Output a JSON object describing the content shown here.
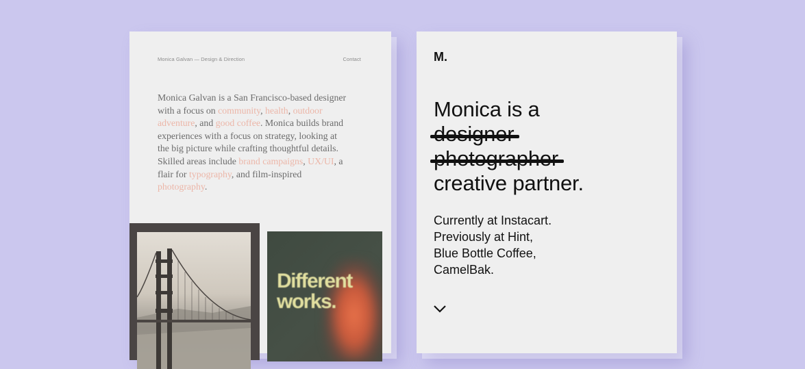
{
  "left": {
    "nav": {
      "title": "Monica Galvan — Design & Direction",
      "contact": "Contact"
    },
    "bio": [
      {
        "text": "Monica Galvan is a San Francisco-based designer with a focus on ",
        "hl": false
      },
      {
        "text": "community",
        "hl": true
      },
      {
        "text": ", ",
        "hl": false
      },
      {
        "text": "health",
        "hl": true
      },
      {
        "text": ", ",
        "hl": false
      },
      {
        "text": "outdoor adventure",
        "hl": true
      },
      {
        "text": ", and ",
        "hl": false
      },
      {
        "text": "good coffee",
        "hl": true
      },
      {
        "text": ". Monica builds brand experiences with a focus on strategy, looking at the big picture while crafting thoughtful details. Skilled areas include ",
        "hl": false
      },
      {
        "text": "brand campaigns",
        "hl": true
      },
      {
        "text": ", ",
        "hl": false
      },
      {
        "text": "UX/UI",
        "hl": true
      },
      {
        "text": ", a flair for ",
        "hl": false
      },
      {
        "text": "typography",
        "hl": true
      },
      {
        "text": ", and film-inspired ",
        "hl": false
      },
      {
        "text": "photography",
        "hl": true
      },
      {
        "text": ".",
        "hl": false
      }
    ],
    "poster": {
      "line1": "Different",
      "line2": "works."
    }
  },
  "right": {
    "logo": "M.",
    "headline": {
      "line1": "Monica is a",
      "struck1": "designer",
      "struck2": "photographer",
      "line4": "creative partner."
    },
    "roles": [
      "Currently at Instacart.",
      "Previously at Hint,",
      "Blue Bottle Coffee,",
      "CamelBak."
    ],
    "scroll_icon": "chevron-down-icon"
  },
  "colors": {
    "background": "#cbc7ee",
    "panel": "#efefef",
    "highlight": "#ecb6a8",
    "text_dark": "#111111"
  }
}
